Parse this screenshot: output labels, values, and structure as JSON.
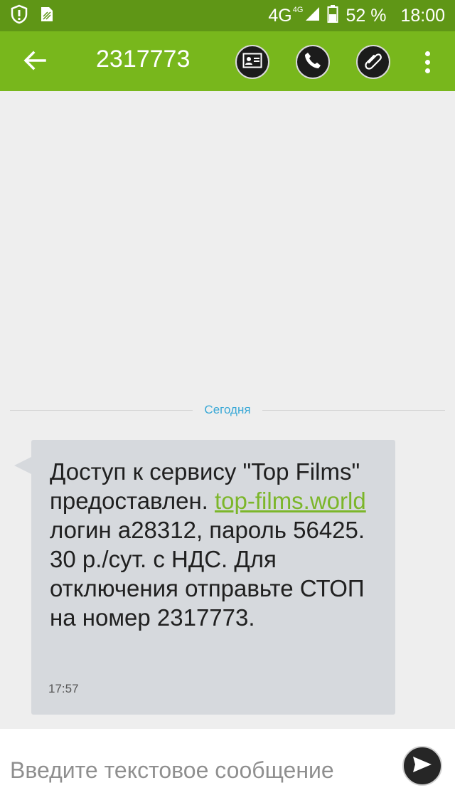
{
  "status_bar": {
    "network_label": "4G",
    "network_superscript": "4G",
    "battery_percent": "52 %",
    "time": "18:00",
    "icons": [
      "shield-alert-icon",
      "sim-signal-icon",
      "cell-signal-icon",
      "battery-icon"
    ]
  },
  "app_bar": {
    "title": "2317773",
    "actions": [
      "contact-card-icon",
      "phone-icon",
      "paperclip-icon",
      "more-vert-icon"
    ],
    "color": "#78b71c"
  },
  "conversation": {
    "date_label": "Сегодня",
    "message": {
      "text_before_link": "Доступ к сервису \"Top Films\" предоставлен. ",
      "link": "top-films.world",
      "text_after_link": " логин а28312, пароль 56425. 30 р./сут. с НДС. Для отключения отправьте СТОП на номер 2317773.",
      "time": "17:57"
    }
  },
  "composer": {
    "placeholder": "Введите текстовое сообщение",
    "value": "",
    "send_icon": "send-icon"
  }
}
